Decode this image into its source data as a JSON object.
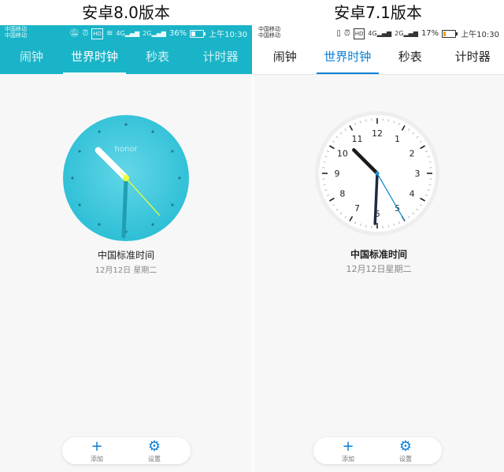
{
  "captions": {
    "left": "安卓8.0版本",
    "right": "安卓7.1版本"
  },
  "left": {
    "status": {
      "carrier_line1": "中国移动",
      "carrier_line2": "中国移动",
      "battery": "36%",
      "time": "上午10:30",
      "net1": "4G",
      "net2": "2G"
    },
    "tabs": [
      "闹钟",
      "世界时钟",
      "秒表",
      "计时器"
    ],
    "active_tab": 1,
    "clock": {
      "brand": "honor",
      "hour": 10,
      "minute": 30,
      "second": 23
    },
    "city": "中国标准时间",
    "date": "12月12日 星期二",
    "actions": {
      "add": "添加",
      "settings": "设置"
    },
    "colors": {
      "accent": "#1ab4c8",
      "face": "#3fcbe0",
      "second_hand": "#e8ff3a"
    }
  },
  "right": {
    "status": {
      "carrier_line1": "中国移动",
      "carrier_line2": "中国移动",
      "battery": "17%",
      "time": "上午10:30",
      "net1": "4G",
      "net2": "2G"
    },
    "tabs": [
      "闹钟",
      "世界时钟",
      "秒表",
      "计时器"
    ],
    "active_tab": 1,
    "clock": {
      "numbers": [
        "12",
        "1",
        "2",
        "3",
        "4",
        "5",
        "6",
        "7",
        "8",
        "9",
        "10",
        "11"
      ],
      "hour": 10,
      "minute": 30,
      "second": 25
    },
    "city": "中国标准时间",
    "date": "12月12日星期二",
    "actions": {
      "add": "添加",
      "settings": "设置"
    },
    "colors": {
      "accent": "#0a7fd6",
      "second_hand": "#1a8fd0"
    }
  }
}
